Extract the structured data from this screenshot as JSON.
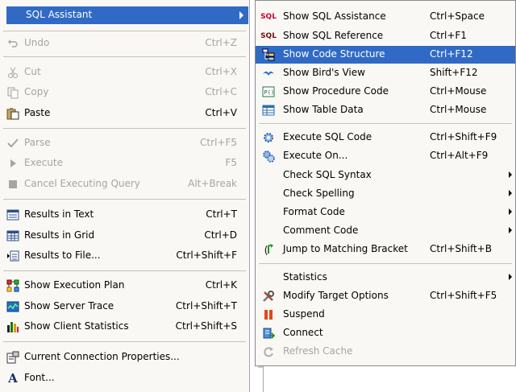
{
  "main_menu": {
    "header": {
      "label": "SQL Assistant"
    },
    "items": [
      {
        "label": "Undo",
        "shortcut": "Ctrl+Z",
        "icon": "undo-icon",
        "disabled": true
      },
      {
        "label": "Cut",
        "shortcut": "Ctrl+X",
        "icon": "scissors-icon",
        "disabled": true
      },
      {
        "label": "Copy",
        "shortcut": "Ctrl+C",
        "icon": "copy-icon",
        "disabled": true
      },
      {
        "label": "Paste",
        "shortcut": "Ctrl+V",
        "icon": "paste-icon",
        "disabled": false
      },
      {
        "label": "Parse",
        "shortcut": "Ctrl+F5",
        "icon": "checkmark-icon",
        "disabled": true
      },
      {
        "label": "Execute",
        "shortcut": "F5",
        "icon": "play-icon",
        "disabled": true
      },
      {
        "label": "Cancel Executing Query",
        "shortcut": "Alt+Break",
        "icon": "stop-icon",
        "disabled": true
      },
      {
        "label": "Results in Text",
        "shortcut": "Ctrl+T",
        "icon": "results-text-icon",
        "disabled": false
      },
      {
        "label": "Results in Grid",
        "shortcut": "Ctrl+D",
        "icon": "results-grid-icon",
        "disabled": false
      },
      {
        "label": "Results to File...",
        "shortcut": "Ctrl+Shift+F",
        "icon": "results-file-icon",
        "disabled": false
      },
      {
        "label": "Show Execution Plan",
        "shortcut": "Ctrl+K",
        "icon": "execution-plan-icon",
        "disabled": false
      },
      {
        "label": "Show Server Trace",
        "shortcut": "Ctrl+Shift+T",
        "icon": "server-trace-icon",
        "disabled": false
      },
      {
        "label": "Show Client Statistics",
        "shortcut": "Ctrl+Shift+S",
        "icon": "client-statistics-icon",
        "disabled": false
      },
      {
        "label": "Current Connection Properties...",
        "shortcut": "",
        "icon": "connection-properties-icon",
        "disabled": false
      },
      {
        "label": "Font...",
        "shortcut": "",
        "icon": "font-icon",
        "disabled": false
      }
    ]
  },
  "sub_menu": {
    "items": [
      {
        "label": "Show SQL Assistance",
        "shortcut": "Ctrl+Space",
        "icon": "sql-assistance-icon"
      },
      {
        "label": "Show SQL Reference",
        "shortcut": "Ctrl+F1",
        "icon": "sql-reference-icon"
      },
      {
        "label": "Show Code Structure",
        "shortcut": "Ctrl+F12",
        "icon": "code-structure-icon",
        "highlighted": true
      },
      {
        "label": "Show Bird's View",
        "shortcut": "Shift+F12",
        "icon": "birds-view-icon"
      },
      {
        "label": "Show Procedure Code",
        "shortcut": "Ctrl+Mouse",
        "icon": "procedure-code-icon"
      },
      {
        "label": "Show Table Data",
        "shortcut": "Ctrl+Mouse",
        "icon": "table-data-icon"
      },
      {
        "label": "Execute SQL Code",
        "shortcut": "Ctrl+Shift+F9",
        "icon": "gear-icon"
      },
      {
        "label": "Execute On...",
        "shortcut": "Ctrl+Alt+F9",
        "icon": "gears-icon"
      },
      {
        "label": "Check SQL Syntax",
        "shortcut": "",
        "submenu": true
      },
      {
        "label": "Check Spelling",
        "shortcut": "",
        "submenu": true
      },
      {
        "label": "Format Code",
        "shortcut": "",
        "submenu": true
      },
      {
        "label": "Comment Code",
        "shortcut": "",
        "submenu": true
      },
      {
        "label": "Jump to Matching Bracket",
        "shortcut": "Ctrl+Shift+B",
        "icon": "bracket-jump-icon"
      },
      {
        "label": "Statistics",
        "shortcut": "",
        "submenu": true
      },
      {
        "label": "Modify Target Options",
        "shortcut": "Ctrl+Shift+F5",
        "icon": "tools-icon"
      },
      {
        "label": "Suspend",
        "shortcut": "",
        "icon": "pause-icon"
      },
      {
        "label": "Connect",
        "shortcut": "",
        "icon": "connect-icon"
      },
      {
        "label": "Refresh Cache",
        "shortcut": "",
        "icon": "refresh-icon",
        "disabled": true
      }
    ]
  },
  "colors": {
    "highlight": "#316ac5",
    "menu_bg": "#f9f8f4",
    "disabled_text": "#a6a5a0"
  }
}
